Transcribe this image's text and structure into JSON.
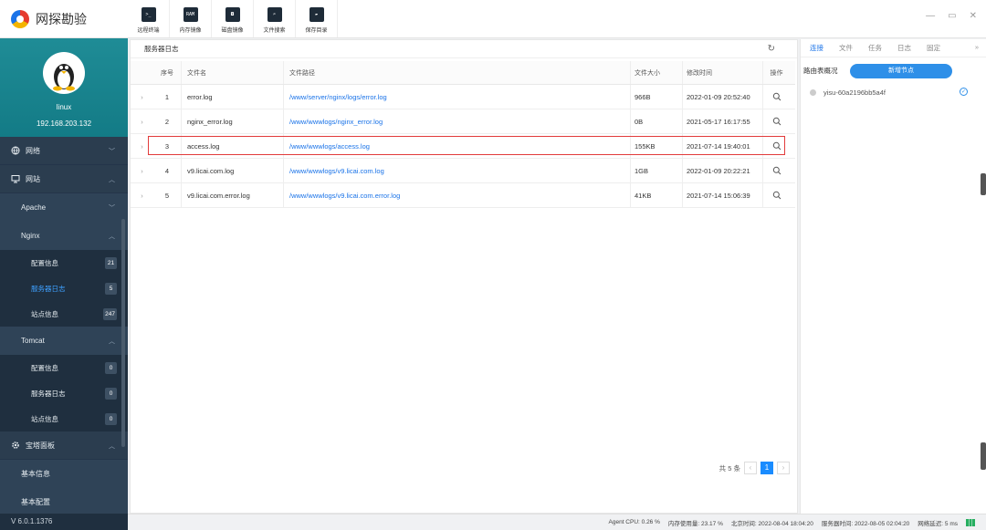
{
  "app": {
    "name": "网探勘验",
    "version": "V 6.0.1.1376"
  },
  "profile": {
    "name": "linux",
    "ip": "192.168.203.132"
  },
  "toolbar": [
    {
      "label": "远程终端",
      "icon": ">_"
    },
    {
      "label": "内存镜像",
      "icon": "RAM"
    },
    {
      "label": "磁盘镜像",
      "icon": "◘"
    },
    {
      "label": "文件搜索",
      "icon": "⌕"
    },
    {
      "label": "保存目录",
      "icon": "▰"
    }
  ],
  "sidebar": {
    "network": "网络",
    "website": "网站",
    "apache": "Apache",
    "nginx": "Nginx",
    "nginx_items": [
      {
        "label": "配置信息",
        "count": "21"
      },
      {
        "label": "服务器日志",
        "count": "5"
      },
      {
        "label": "站点信息",
        "count": "247"
      }
    ],
    "tomcat": "Tomcat",
    "tomcat_items": [
      {
        "label": "配置信息",
        "count": "0"
      },
      {
        "label": "服务器日志",
        "count": "0"
      },
      {
        "label": "站点信息",
        "count": "0"
      }
    ],
    "baota": "宝塔面板",
    "baota_items": [
      "基本信息",
      "基本配置"
    ]
  },
  "main": {
    "title": "服务器日志",
    "headers": [
      "序号",
      "文件名",
      "文件路径",
      "文件大小",
      "修改时间",
      "操作"
    ],
    "rows": [
      {
        "no": "1",
        "name": "error.log",
        "path": "/www/server/nginx/logs/error.log",
        "size": "966B",
        "time": "2022-01-09 20:52:40"
      },
      {
        "no": "2",
        "name": "nginx_error.log",
        "path": "/www/wwwlogs/nginx_error.log",
        "size": "0B",
        "time": "2021-05-17 16:17:55"
      },
      {
        "no": "3",
        "name": "access.log",
        "path": "/www/wwwlogs/access.log",
        "size": "155KB",
        "time": "2021-07-14 19:40:01"
      },
      {
        "no": "4",
        "name": "v9.licai.com.log",
        "path": "/www/wwwlogs/v9.licai.com.log",
        "size": "1GB",
        "time": "2022-01-09 20:22:21"
      },
      {
        "no": "5",
        "name": "v9.licai.com.error.log",
        "path": "/www/wwwlogs/v9.licai.com.error.log",
        "size": "41KB",
        "time": "2021-07-14 15:06:39"
      }
    ],
    "highlighted_row": 3,
    "total": "共 5 条",
    "page": "1"
  },
  "right": {
    "tabs": [
      "连接",
      "文件",
      "任务",
      "日志",
      "固定"
    ],
    "route_label": "路由表概况",
    "add_node": "新增节点",
    "node": "yisu-60a2196bb5a4f"
  },
  "status": {
    "cpu": "Agent CPU: 0.26 %",
    "mem": "内存使用量: 23.17 %",
    "beijing": "北京时间: 2022-08-04 18:04:20",
    "server": "服务器时间: 2022-08-05 02:04:20",
    "latency": "网络延迟: 5 ms"
  },
  "colors": {
    "accent": "#1a73e8",
    "sidebar": "#2b3d4f",
    "highlight": "#e23b3b"
  }
}
